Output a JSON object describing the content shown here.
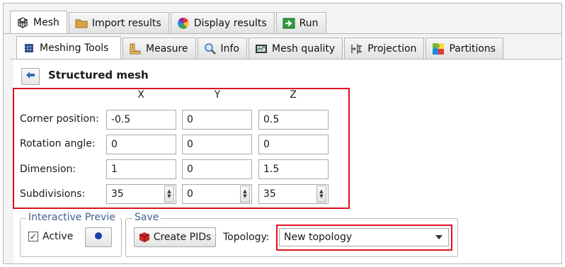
{
  "main_tabs": [
    {
      "label": "Mesh",
      "icon": "mesh-grid-icon",
      "active": true
    },
    {
      "label": "Import results",
      "icon": "folder-icon",
      "active": false
    },
    {
      "label": "Display results",
      "icon": "color-wheel-icon",
      "active": false
    },
    {
      "label": "Run",
      "icon": "run-arrow-icon",
      "active": false
    }
  ],
  "sub_tabs": [
    {
      "label": "Meshing Tools",
      "icon": "mesh-cube-icon",
      "active": true
    },
    {
      "label": "Measure",
      "icon": "ruler-icon",
      "active": false
    },
    {
      "label": "Info",
      "icon": "info-magnifier-icon",
      "active": false
    },
    {
      "label": "Mesh quality",
      "icon": "mesh-quality-icon",
      "active": false
    },
    {
      "label": "Projection",
      "icon": "projection-icon",
      "active": false
    },
    {
      "label": "Partitions",
      "icon": "puzzle-icon",
      "active": false
    }
  ],
  "section": {
    "title": "Structured mesh",
    "back_icon": "back-arrow-icon"
  },
  "grid": {
    "columns": [
      "X",
      "Y",
      "Z"
    ],
    "rows": [
      {
        "label": "Corner position:",
        "values": [
          "-0.5",
          "0",
          "0.5"
        ]
      },
      {
        "label": "Rotation angle:",
        "values": [
          "0",
          "0",
          "0"
        ]
      },
      {
        "label": "Dimension:",
        "values": [
          "1",
          "0",
          "1.5"
        ]
      },
      {
        "label": "Subdivisions:",
        "values": [
          "35",
          "0",
          "35"
        ]
      }
    ]
  },
  "preview": {
    "group_title": "Interactive Previe",
    "active_label": "Active",
    "active_checked": true,
    "check_mark": "✓"
  },
  "save": {
    "group_title": "Save",
    "create_pids_label": "Create PIDs",
    "topology_label": "Topology:",
    "topology_value": "New topology"
  },
  "colors": {
    "highlight": "#e0101e",
    "accent": "#2f5fb0"
  }
}
